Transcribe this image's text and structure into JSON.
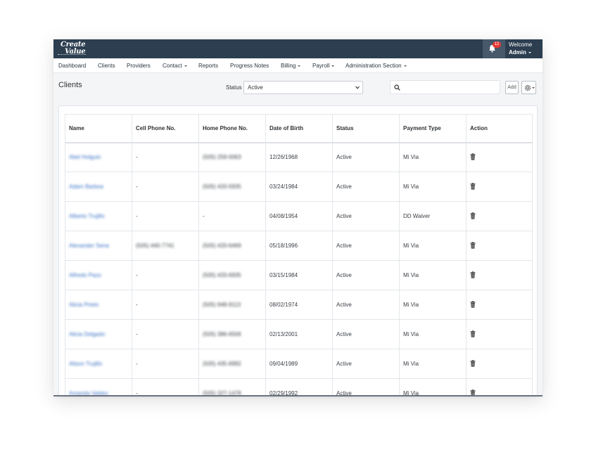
{
  "header": {
    "logo_line1": "Create",
    "logo_line2": "Value",
    "notification_count": "12",
    "welcome_label": "Welcome",
    "user_name": "Admin"
  },
  "nav": {
    "items": [
      {
        "label": "Dashboard",
        "dropdown": false
      },
      {
        "label": "Clients",
        "dropdown": false
      },
      {
        "label": "Providers",
        "dropdown": false
      },
      {
        "label": "Contact",
        "dropdown": true
      },
      {
        "label": "Reports",
        "dropdown": false
      },
      {
        "label": "Progress Notes",
        "dropdown": false
      },
      {
        "label": "Billing",
        "dropdown": true
      },
      {
        "label": "Payroll",
        "dropdown": true
      },
      {
        "label": "Administration Section",
        "dropdown": true
      }
    ]
  },
  "page": {
    "title": "Clients",
    "status_label": "Status",
    "status_value": "Active",
    "search_placeholder": "",
    "add_label": "Add"
  },
  "table": {
    "columns": [
      "Name",
      "Cell Phone No.",
      "Home Phone No.",
      "Date of Birth",
      "Status",
      "Payment Type",
      "Action"
    ],
    "rows": [
      {
        "name": "Abel Holguin",
        "cell": "-",
        "home": "(505) 259-0063",
        "dob": "12/26/1968",
        "status": "Active",
        "payment": "Mi Via"
      },
      {
        "name": "Adam Barboa",
        "cell": "-",
        "home": "(505) 433-5935",
        "dob": "03/24/1984",
        "status": "Active",
        "payment": "Mi Via"
      },
      {
        "name": "Alberto Trujillo",
        "cell": "-",
        "home": "-",
        "dob": "04/08/1954",
        "status": "Active",
        "payment": "DD Waiver"
      },
      {
        "name": "Alexander Sena",
        "cell": "(505) 440-7741",
        "home": "(505) 433-6469",
        "dob": "05/18/1996",
        "status": "Active",
        "payment": "Mi Via"
      },
      {
        "name": "Alfredo Pazo",
        "cell": "-",
        "home": "(505) 433-6935",
        "dob": "03/15/1984",
        "status": "Active",
        "payment": "Mi Via"
      },
      {
        "name": "Alicia Prieto",
        "cell": "-",
        "home": "(505) 948-9113",
        "dob": "08/02/1974",
        "status": "Active",
        "payment": "Mi Via"
      },
      {
        "name": "Alicia Delgado",
        "cell": "-",
        "home": "(505) 386-6506",
        "dob": "02/13/2001",
        "status": "Active",
        "payment": "Mi Via"
      },
      {
        "name": "Alison Trujillo",
        "cell": "-",
        "home": "(505) 435-6992",
        "dob": "09/04/1989",
        "status": "Active",
        "payment": "Mi Via"
      },
      {
        "name": "Amanda Valdez",
        "cell": "-",
        "home": "(505) 327-1478",
        "dob": "02/29/1992",
        "status": "Active",
        "payment": "Mi Via"
      }
    ]
  },
  "colors": {
    "header_bg": "#2c3e50",
    "link": "#3b72c4",
    "badge": "#e53935"
  },
  "icons": [
    "bell-icon",
    "search-icon",
    "gear-icon",
    "trash-icon",
    "chevron-down-icon"
  ]
}
